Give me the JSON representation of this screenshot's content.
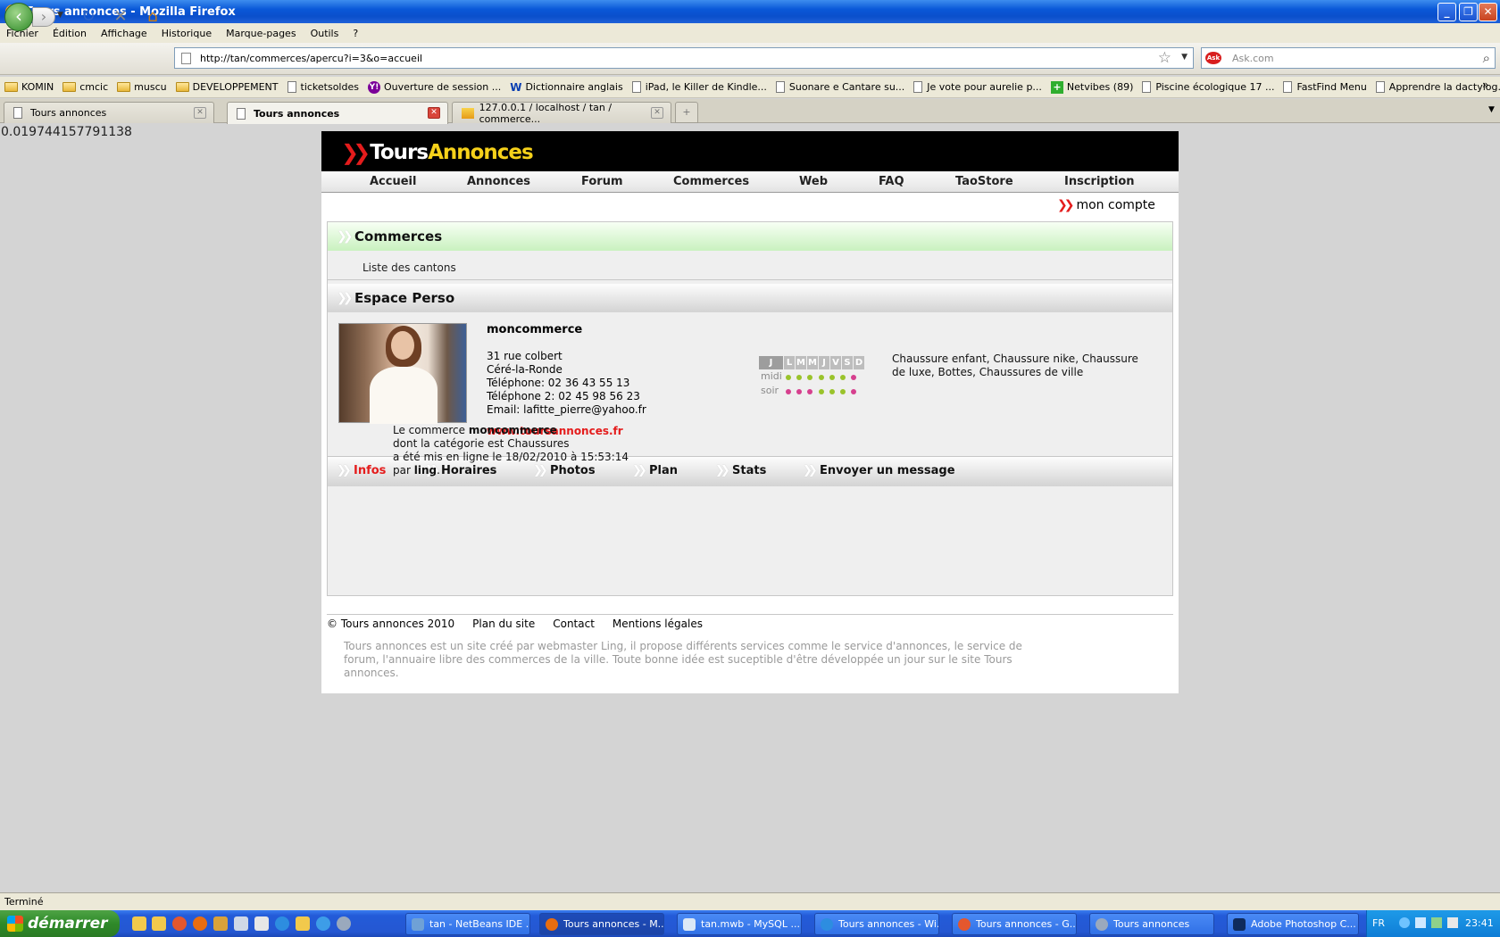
{
  "window": {
    "title": "Tours annonces - Mozilla Firefox"
  },
  "menu": [
    "Fichier",
    "Édition",
    "Affichage",
    "Historique",
    "Marque-pages",
    "Outils",
    "?"
  ],
  "nav": {
    "url": "http://tan/commerces/apercu?i=3&o=accueil",
    "search_placeholder": "Ask.com",
    "search_engine": "Ask"
  },
  "bookmarks": [
    {
      "label": "KOMIN",
      "icon": "folder"
    },
    {
      "label": "cmcic",
      "icon": "folder"
    },
    {
      "label": "muscu",
      "icon": "folder"
    },
    {
      "label": "DEVELOPPEMENT",
      "icon": "folder"
    },
    {
      "label": "ticketsoldes",
      "icon": "page"
    },
    {
      "label": "Ouverture de session ...",
      "icon": "yahoo"
    },
    {
      "label": "Dictionnaire anglais",
      "icon": "wr"
    },
    {
      "label": "iPad, le Killer de Kindle...",
      "icon": "page"
    },
    {
      "label": "Suonare e Cantare su...",
      "icon": "page"
    },
    {
      "label": "Je vote pour aurelie p...",
      "icon": "page"
    },
    {
      "label": "Netvibes (89)",
      "icon": "netvibes"
    },
    {
      "label": "Piscine écologique 17 ...",
      "icon": "page"
    },
    {
      "label": "FastFind Menu",
      "icon": "page"
    },
    {
      "label": "Apprendre la dactylog...",
      "icon": "page"
    }
  ],
  "tabs": [
    {
      "label": "Tours annonces",
      "active": false
    },
    {
      "label": "Tours annonces",
      "active": true
    },
    {
      "label": "127.0.0.1 / localhost / tan / commerce...",
      "active": false
    }
  ],
  "debug_value": "0.019744157791138",
  "site": {
    "logo_part1": "Tours",
    "logo_part2": "Annonces",
    "nav": [
      "Accueil",
      "Annonces",
      "Forum",
      "Commerces",
      "Web",
      "FAQ",
      "TaoStore",
      "Inscription"
    ],
    "account": "mon compte",
    "section1": {
      "title": "Commerces",
      "link": "Liste des cantons"
    },
    "section2": {
      "title": "Espace Perso"
    },
    "shop": {
      "name": "moncommerce",
      "address": "31 rue colbert",
      "city": "Céré-la-Ronde",
      "phone": "Téléphone: 02 36 43 55 13",
      "phone2": "Téléphone 2: 02 45 98 56 23",
      "email": "Email: lafitte_pierre@yahoo.fr",
      "website": "www.toursannonces.fr",
      "categories": "Chaussure enfant, Chaussure nike, Chaussure de luxe, Bottes, Chaussures de ville"
    },
    "schedule": {
      "header": "J",
      "days": [
        "L",
        "M",
        "M",
        "J",
        "V",
        "S",
        "D"
      ],
      "rows": [
        {
          "label": "midi",
          "open": [
            true,
            true,
            true,
            true,
            true,
            true,
            false
          ]
        },
        {
          "label": "soir",
          "open": [
            false,
            false,
            false,
            true,
            true,
            true,
            false
          ]
        }
      ],
      "open_color": "#9ac32b",
      "closed_color": "#d6408e"
    },
    "shop_tabs": [
      "Infos",
      "Horaires",
      "Photos",
      "Plan",
      "Stats",
      "Envoyer un message"
    ],
    "info": {
      "line1_prefix": "Le commerce ",
      "line1_name": "moncommerce",
      "line2": "dont la catégorie est Chaussures",
      "line3": "a été mis en ligne le 18/02/2010 à 15:53:14",
      "line4_prefix": "par ",
      "line4_user": "ling",
      "line4_suffix": "."
    },
    "footer": {
      "copyright": "© Tours annonces 2010",
      "links": [
        "Plan du site",
        "Contact",
        "Mentions légales"
      ],
      "description": "Tours annonces est un site créé par webmaster Ling, il propose différents services comme le service d'annonces, le service de forum, l'annuaire libre des commerces de la ville. Toute bonne idée est suceptible d'être développée un jour sur le site Tours annonces."
    },
    "accent_color": "#e41c1c"
  },
  "status": "Terminé",
  "taskbar": {
    "start": "démarrer",
    "tasks": [
      "tan - NetBeans IDE ...",
      "Tours annonces - M...",
      "tan.mwb - MySQL ...",
      "Tours annonces - Wi...",
      "Tours annonces - G...",
      "Tours annonces",
      "Adobe Photoshop C..."
    ],
    "lang": "FR",
    "clock": "23:41"
  }
}
